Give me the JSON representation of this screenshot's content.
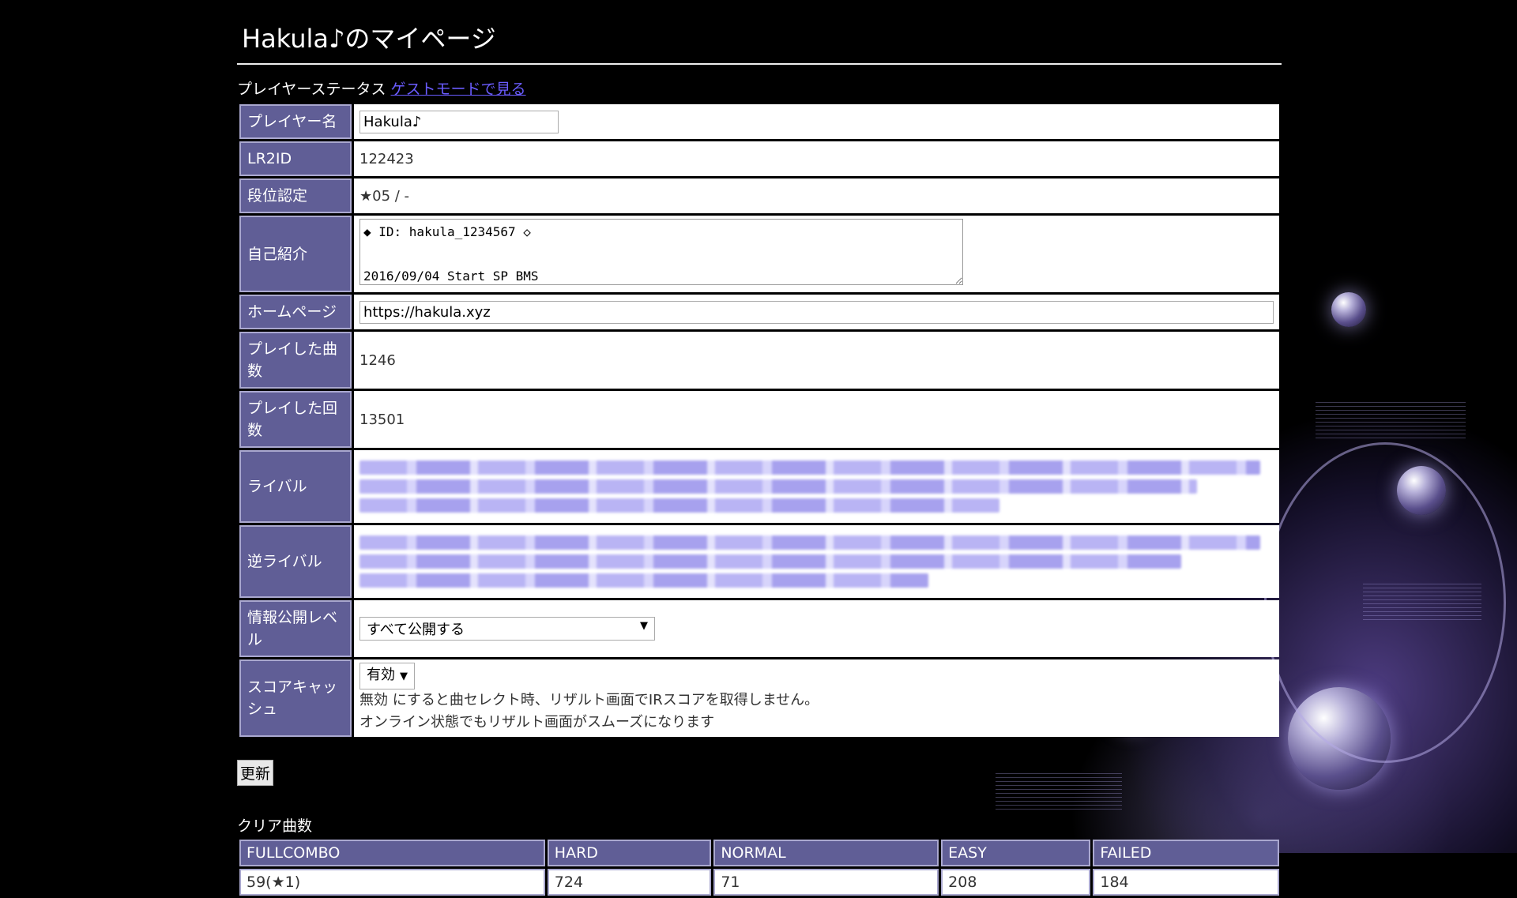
{
  "page": {
    "title": "Hakula♪のマイページ"
  },
  "status": {
    "heading": "プレイヤーステータス",
    "guest_link": "ゲストモードで見る"
  },
  "profile": {
    "player_name_label": "プレイヤー名",
    "player_name_value": "Hakula♪",
    "lr2id_label": "LR2ID",
    "lr2id_value": "122423",
    "dan_label": "段位認定",
    "dan_value": "★05 / -",
    "intro_label": "自己紹介",
    "intro_value": "◆ ID: hakula_1234567 ◇\n\n2016/09/04 Start SP BMS",
    "homepage_label": "ホームページ",
    "homepage_value": "https://hakula.xyz",
    "songs_played_label": "プレイした曲数",
    "songs_played_value": "1246",
    "play_count_label": "プレイした回数",
    "play_count_value": "13501",
    "rival_label": "ライバル",
    "reverse_rival_label": "逆ライバル",
    "visibility_label": "情報公開レベル",
    "visibility_value": "すべて公開する",
    "score_cache_label": "スコアキャッシュ",
    "score_cache_value": "有効",
    "score_cache_note_1": "無効 にすると曲セレクト時、リザルト画面でIRスコアを取得しません。",
    "score_cache_note_2": "オンライン状態でもリザルト画面がスムーズになります"
  },
  "actions": {
    "update_label": "更新"
  },
  "clear": {
    "title": "クリア曲数",
    "headers": [
      "FULLCOMBO",
      "HARD",
      "NORMAL",
      "EASY",
      "FAILED"
    ],
    "values": [
      "59(★1)",
      "724",
      "71",
      "208",
      "184"
    ]
  }
}
